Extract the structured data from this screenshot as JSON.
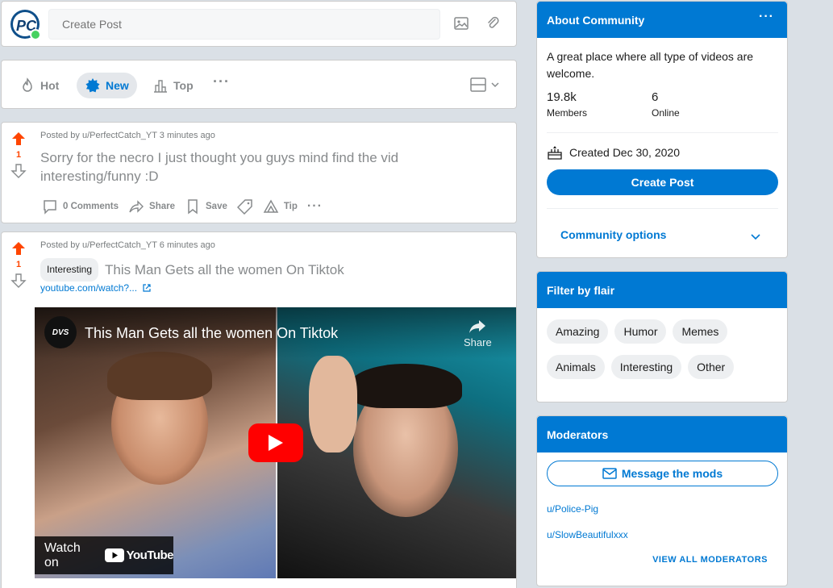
{
  "create_post": {
    "avatar_text": "PC",
    "placeholder": "Create Post"
  },
  "sort": {
    "hot": "Hot",
    "new": "New",
    "top": "Top",
    "more": "···"
  },
  "posts": [
    {
      "score": "1",
      "meta": "Posted by u/PerfectCatch_YT 3 minutes ago",
      "title": "Sorry for the necro I just thought you guys mind find the vid interesting/funny :D",
      "comments": "0 Comments",
      "share": "Share",
      "save": "Save",
      "tip": "Tip",
      "more": "···"
    },
    {
      "score": "1",
      "meta": "Posted by u/PerfectCatch_YT 6 minutes ago",
      "flair": "Interesting",
      "title": "This Man Gets all the women On Tiktok",
      "link": "youtube.com/watch?...",
      "video": {
        "channel_logo": "DVS",
        "title": "This Man Gets all the women On Tiktok",
        "share": "Share",
        "watch_on": "Watch on",
        "youtube": "YouTube"
      }
    }
  ],
  "about": {
    "header": "About Community",
    "more": "···",
    "description": "A great place where all type of videos are welcome.",
    "members_count": "19.8k",
    "members_label": "Members",
    "online_count": "6",
    "online_label": "Online",
    "created": "Created Dec 30, 2020",
    "create_post": "Create Post",
    "community_options": "Community options"
  },
  "flair_filter": {
    "header": "Filter by flair",
    "flairs": [
      "Amazing",
      "Humor",
      "Memes",
      "Animals",
      "Interesting",
      "Other"
    ]
  },
  "moderators": {
    "header": "Moderators",
    "message": "Message the mods",
    "list": [
      "u/Police-Pig",
      "u/SlowBeautifulxxx"
    ],
    "view_all": "VIEW ALL MODERATORS"
  },
  "colors": {
    "brand_blue": "#0079d3",
    "upvote_orange": "#ff4500",
    "page_bg": "#dae0e6"
  }
}
